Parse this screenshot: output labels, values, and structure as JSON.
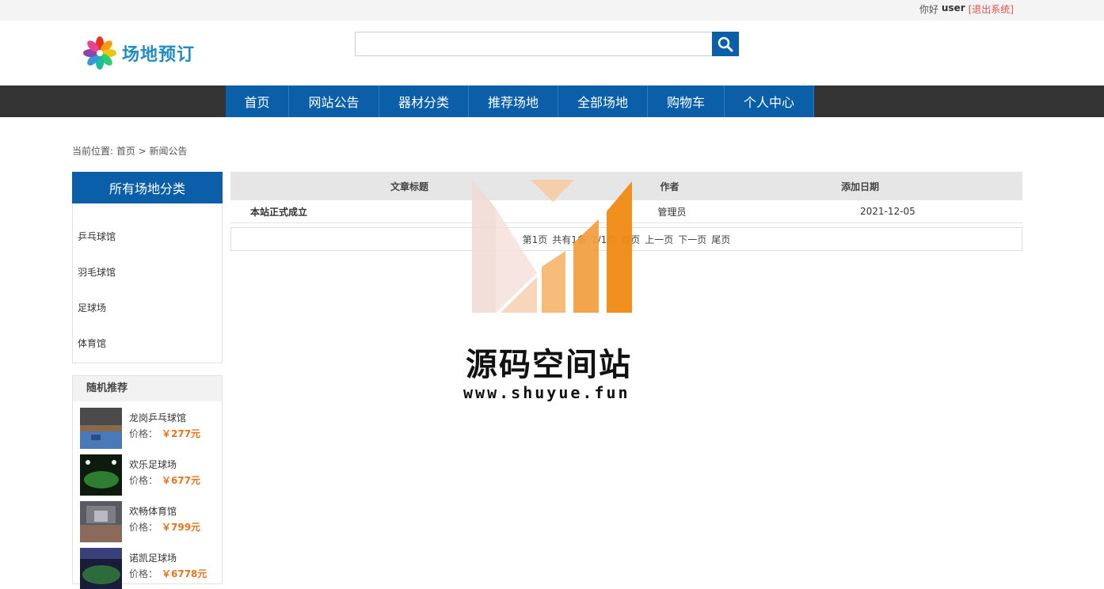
{
  "topbar": {
    "greeting": "你好",
    "username": "user",
    "logout": "[退出系统]"
  },
  "header": {
    "logo_text": "场地预订",
    "search_placeholder": ""
  },
  "nav": {
    "items": [
      "首页",
      "网站公告",
      "器材分类",
      "推荐场地",
      "全部场地",
      "购物车",
      "个人中心"
    ]
  },
  "breadcrumb": "当前位置: 首页 > 新闻公告",
  "sidebar": {
    "title": "所有场地分类",
    "items": [
      "乒乓球馆",
      "羽毛球馆",
      "足球场",
      "体育馆"
    ]
  },
  "recommend": {
    "title": "随机推荐",
    "price_label": "价格：",
    "items": [
      {
        "name": "龙岗乒乓球馆",
        "price": "￥277元"
      },
      {
        "name": "欢乐足球场",
        "price": "￥677元"
      },
      {
        "name": "欢畅体育馆",
        "price": "￥799元"
      },
      {
        "name": "诺凯足球场",
        "price": "￥6778元"
      }
    ]
  },
  "table": {
    "headers": {
      "title": "文章标题",
      "author": "作者",
      "date": "添加日期"
    },
    "rows": [
      {
        "title": "本站正式成立",
        "author": "管理员",
        "date": "2021-12-05"
      }
    ]
  },
  "pager": {
    "page_info": "第1页",
    "total": "共有1条",
    "pages": "1/1页",
    "first": "首页",
    "prev": "上一页",
    "next": "下一页",
    "last": "尾页"
  },
  "watermark": {
    "title": "源码空间站",
    "url": "www.shuyue.fun"
  },
  "colors": {
    "primary": "#0a5fa8",
    "nav_bg": "#333333",
    "price": "#e8751a",
    "logout": "#d9534f"
  }
}
